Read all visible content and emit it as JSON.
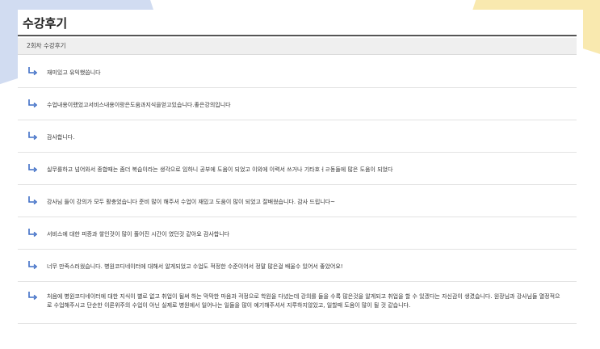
{
  "page": {
    "title": "수강후기",
    "subtitle": "2회차 수강후기"
  },
  "colors": {
    "arrow": "#3f6ec6",
    "rule": "#555555",
    "subheader_bg": "#efefef"
  },
  "reviews": [
    "재미있고 유익했씁니다",
    "수업내용이랬었고서비스내용이랑은도움과지식을얻고있습니다.좋은강의입니다",
    "감사합니다.",
    "실무를하고 넘어와서 종합때는 좀더 복습이라는 생각으로 임하니 공부에 도움이 되었고 이외에 이력서 쓰거나 기타호ㅓㄹ동들에 많은 도움이 되었다",
    "강사님 들이 강의가 모두 활충었습니다 준비 많이 해주셔 수업이 재밌고 도움이 많이 되었고 잘배웠습니다. 감사 드립니다~",
    "서비스에 대한 피증과 쌓인것이 많이 풀어진 시간이 였던것 같아요 감사합니다",
    "너무 만족스러웠습니다. 병원코디네이터에 대해서 알게되었고 수업도 적정한 수준이어서 정말 많은걸 배울수 있어서 좋았어요!",
    "처음에 병원코디네이터에 대한 지식이 별로 없고 취업이 될써 하는 막막한 마음과 걱정으로 학원을 다녔는데 강의를 들을 수록 많은것을 알게되고 취업을 할 수 있겠다는 자신감이 생겼습니다. 원장님과 강사님들 열정적으로 수업해주시고 단순한 이론위주의 수업이 아닌 실제로 병원에서 일어나는 일들을 많이 예기해주셔서 지루하지않았고, 일할때 도움이 많이 될 것 같습니다."
  ]
}
